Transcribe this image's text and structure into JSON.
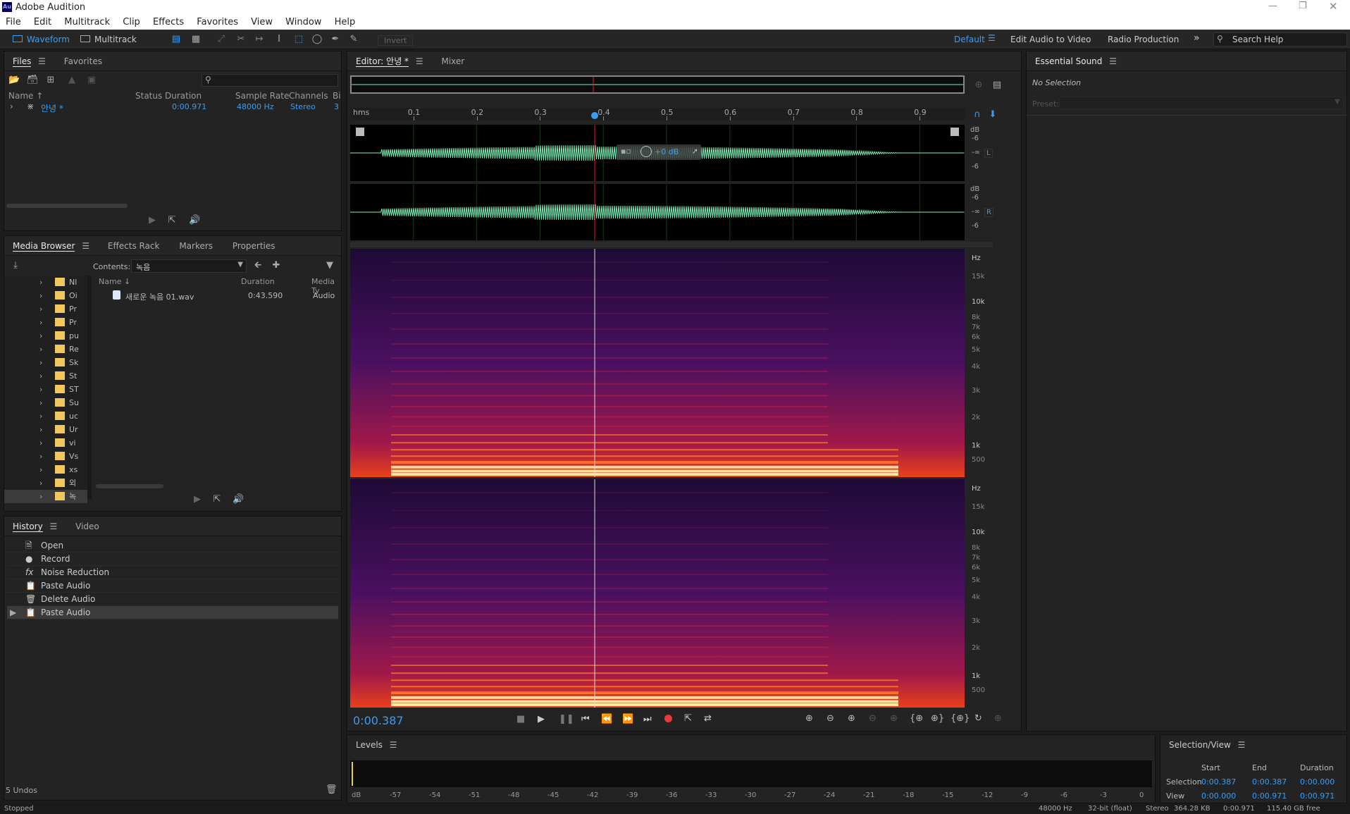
{
  "app": {
    "title": "Adobe Audition",
    "logo": "Au"
  },
  "menu": [
    "File",
    "Edit",
    "Multitrack",
    "Clip",
    "Effects",
    "Favorites",
    "View",
    "Window",
    "Help"
  ],
  "toolbar": {
    "waveform": "Waveform",
    "multitrack": "Multitrack",
    "invert": "Invert",
    "workspaces": [
      "Default",
      "Edit Audio to Video",
      "Radio Production"
    ],
    "search_placeholder": "Search Help"
  },
  "files_panel": {
    "tabs": [
      "Files",
      "Favorites"
    ],
    "columns": [
      "Name ↑",
      "Status",
      "Duration",
      "Sample Rate",
      "Channels",
      "Bi"
    ],
    "rows": [
      {
        "name": "안녕 *",
        "duration": "0:00.971",
        "rate": "48000 Hz",
        "channels": "Stereo",
        "bits": "3"
      }
    ]
  },
  "media_panel": {
    "tabs": [
      "Media Browser",
      "Effects Rack",
      "Markers",
      "Properties"
    ],
    "contents_label": "Contents:",
    "contents_value": "녹음",
    "folders": [
      "Nl",
      "Oi",
      "Pr",
      "Pr",
      "pu",
      "Re",
      "Sk",
      "St",
      "ST",
      "Su",
      "uc",
      "Ur",
      "vi",
      "Vs",
      "xs",
      "외",
      "녹"
    ],
    "columns": [
      "Name ↓",
      "Duration",
      "Media Ty"
    ],
    "files": [
      {
        "name": "새로운 녹음 01.wav",
        "duration": "0:43.590",
        "type": "Audio"
      }
    ]
  },
  "history_panel": {
    "tabs": [
      "History",
      "Video"
    ],
    "items": [
      {
        "icon": "file-icon",
        "label": "Open"
      },
      {
        "icon": "record-dot-icon",
        "label": "Record"
      },
      {
        "icon": "fx-icon",
        "label": "Noise Reduction"
      },
      {
        "icon": "clipboard-icon",
        "label": "Paste Audio"
      },
      {
        "icon": "trash-icon",
        "label": "Delete Audio"
      },
      {
        "icon": "clipboard-icon",
        "label": "Paste Audio"
      }
    ],
    "undos": "5 Undos"
  },
  "editor": {
    "tabs": [
      "Editor: 안녕 *",
      "Mixer"
    ],
    "ruler": [
      "hms",
      "0.1",
      "0.2",
      "0.3",
      "0.4",
      "0.5",
      "0.6",
      "0.7",
      "0.8",
      "0.9"
    ],
    "playhead_fraction": 0.398,
    "hud_gain": "+0 dB",
    "db_labels": [
      "dB",
      "-6",
      "-∞",
      "-6"
    ],
    "hz_labels": [
      "Hz",
      "15k",
      "10k",
      "8k",
      "7k",
      "6k",
      "5k",
      "4k",
      "3k",
      "2k",
      "1k",
      "500"
    ],
    "channel_left": "L",
    "channel_right": "R",
    "time": "0:00.387"
  },
  "essential_sound": {
    "title": "Essential Sound",
    "no_selection": "No Selection",
    "preset_label": "Preset:"
  },
  "levels": {
    "title": "Levels",
    "ticks": [
      "dB",
      "-57",
      "-54",
      "-51",
      "-48",
      "-45",
      "-42",
      "-39",
      "-36",
      "-33",
      "-30",
      "-27",
      "-24",
      "-21",
      "-18",
      "-15",
      "-12",
      "-9",
      "-6",
      "-3",
      "0"
    ]
  },
  "selection_view": {
    "title": "Selection/View",
    "headers": [
      "Start",
      "End",
      "Duration"
    ],
    "rows": [
      {
        "label": "Selection",
        "start": "0:00.387",
        "end": "0:00.387",
        "duration": "0:00.000"
      },
      {
        "label": "View",
        "start": "0:00.000",
        "end": "0:00.971",
        "duration": "0:00.971"
      }
    ]
  },
  "status": {
    "left": "Stopped",
    "rate": "48000 Hz",
    "bit": "32-bit (float)",
    "ch": "Stereo",
    "size": "364.28 KB",
    "dur": "0:00.971",
    "free": "115.40 GB free"
  },
  "colors": {
    "accent": "#3a9df2",
    "waveform": "#7ff2b8",
    "playhead": "#e02020",
    "record": "#e83a3a"
  }
}
